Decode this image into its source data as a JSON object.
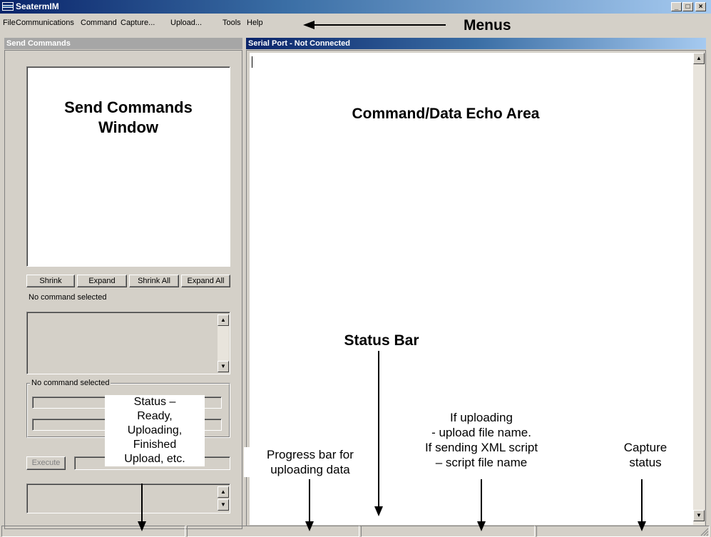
{
  "window": {
    "title": "SeatermIM",
    "minimize": "_",
    "maximize": "□",
    "close": "×"
  },
  "menu": [
    "File",
    "Communications",
    "Command",
    "Capture...",
    "Upload...",
    "Tools",
    "Help"
  ],
  "left_panel": {
    "header": "Send Commands",
    "buttons": {
      "shrink": "Shrink",
      "expand": "Expand",
      "shrink_all": "Shrink All",
      "expand_all": "Expand All"
    },
    "selected_text": "No command selected",
    "group_label": "No command selected",
    "execute": "Execute"
  },
  "right_panel": {
    "header": "Serial Port - Not Connected"
  },
  "annotations": {
    "menus": "Menus",
    "send_commands_window": [
      "Send Commands",
      "Window"
    ],
    "echo_area": "Command/Data Echo Area",
    "status_bar": "Status Bar",
    "status": [
      "Status –",
      "Ready,",
      "Uploading,",
      "Finished",
      "Upload, etc."
    ],
    "progress": [
      "Progress bar for",
      "uploading data"
    ],
    "uploading": [
      "If uploading",
      "- upload file name.",
      "If sending XML script",
      "– script file name"
    ],
    "capture": [
      "Capture",
      "status"
    ]
  },
  "scroll_glyphs": {
    "up": "▲",
    "down": "▼"
  }
}
